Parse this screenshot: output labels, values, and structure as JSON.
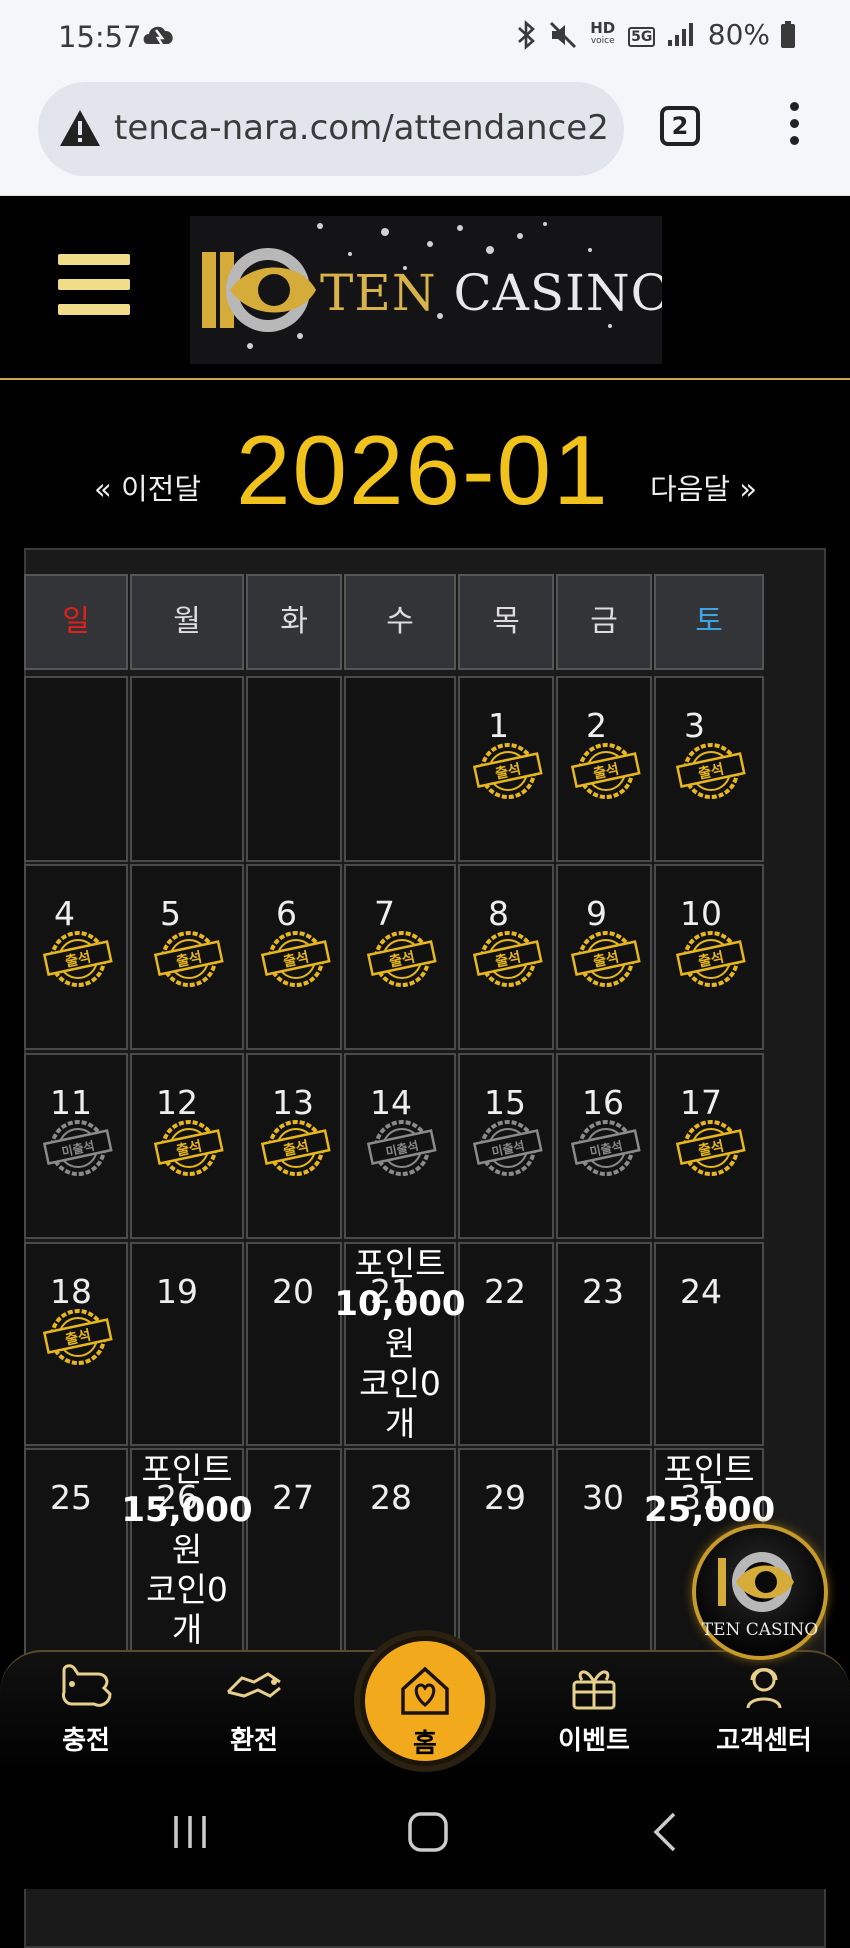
{
  "status": {
    "time": "15:57",
    "battery": "80%",
    "hd_label": "HD",
    "voice_label": "voice",
    "net_label": "5G"
  },
  "browser": {
    "url": "tenca-nara.com/attendance2",
    "tab_count": "2"
  },
  "header": {
    "logo_prefix": "TEN",
    "logo_suffix": "CASINO"
  },
  "calendar": {
    "prev_label": "« 이전달",
    "month": "2026-01",
    "next_label": "다음달 »",
    "weekdays": [
      "일",
      "월",
      "화",
      "수",
      "목",
      "금",
      "토"
    ],
    "weekday_colors": [
      "#e0201c",
      "#dddddd",
      "#dddddd",
      "#dddddd",
      "#dddddd",
      "#dddddd",
      "#3aa6e8"
    ],
    "stamp_attend": "출석",
    "stamp_absent": "미출석",
    "weeks": [
      [
        {
          "day": ""
        },
        {
          "day": ""
        },
        {
          "day": ""
        },
        {
          "day": ""
        },
        {
          "day": "1",
          "stamp": "attend"
        },
        {
          "day": "2",
          "stamp": "attend"
        },
        {
          "day": "3",
          "stamp": "attend"
        }
      ],
      [
        {
          "day": "4",
          "stamp": "attend"
        },
        {
          "day": "5",
          "stamp": "attend"
        },
        {
          "day": "6",
          "stamp": "attend"
        },
        {
          "day": "7",
          "stamp": "attend"
        },
        {
          "day": "8",
          "stamp": "attend"
        },
        {
          "day": "9",
          "stamp": "attend"
        },
        {
          "day": "10",
          "stamp": "attend"
        }
      ],
      [
        {
          "day": "11",
          "stamp": "absent"
        },
        {
          "day": "12",
          "stamp": "attend"
        },
        {
          "day": "13",
          "stamp": "attend"
        },
        {
          "day": "14",
          "stamp": "absent"
        },
        {
          "day": "15",
          "stamp": "absent"
        },
        {
          "day": "16",
          "stamp": "absent"
        },
        {
          "day": "17",
          "stamp": "attend"
        }
      ],
      [
        {
          "day": "18",
          "stamp": "attend"
        },
        {
          "day": "19"
        },
        {
          "day": "20"
        },
        {
          "day": "21",
          "reward": [
            "포인트",
            "10,000",
            "원",
            "코인0",
            "개"
          ]
        },
        {
          "day": "22"
        },
        {
          "day": "23"
        },
        {
          "day": "24"
        }
      ],
      [
        {
          "day": "25"
        },
        {
          "day": "26",
          "reward": [
            "포인트",
            "15,000",
            "원",
            "코인0",
            "개"
          ]
        },
        {
          "day": "27"
        },
        {
          "day": "28"
        },
        {
          "day": "29"
        },
        {
          "day": "30"
        },
        {
          "day": "31",
          "reward": [
            "포인트",
            "25,000"
          ]
        }
      ]
    ]
  },
  "float_button": {
    "label": "TEN CASINO"
  },
  "bottom_nav": [
    {
      "id": "charge",
      "label": "충전"
    },
    {
      "id": "exchange",
      "label": "환전"
    },
    {
      "id": "home",
      "label": "홈"
    },
    {
      "id": "event",
      "label": "이벤트"
    },
    {
      "id": "support",
      "label": "고객센터"
    }
  ]
}
